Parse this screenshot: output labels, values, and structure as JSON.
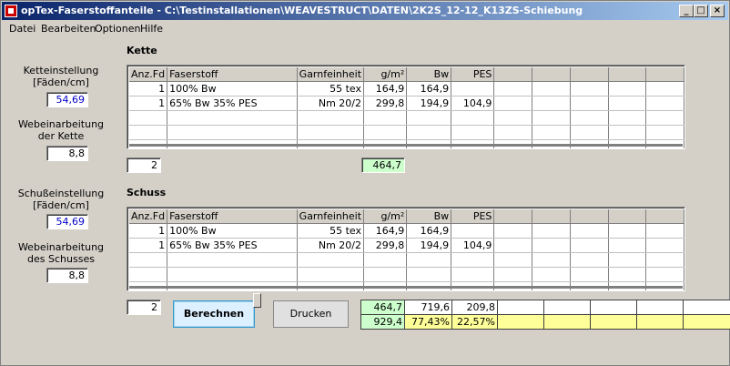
{
  "window": {
    "title": "opTex-Faserstoffanteile - C:\\Testinstallationen\\WEAVESTRUCT\\DATEN\\2K2S_12-12_K13ZS-Schiebung"
  },
  "menu": [
    "Datei",
    "Bearbeiten",
    "Optionen",
    "Hilfe"
  ],
  "kette": {
    "title": "Kette",
    "einstellung_label": "Ketteinstellung\n[Fäden/cm]",
    "einstellung_value": "54,69",
    "webe_label": "Webeinarbeitung\nder Kette",
    "webe_value": "8,8",
    "count": "2",
    "sum_gm2": "464,7",
    "columns": [
      "Anz.Fd",
      "Faserstoff",
      "Garnfeinheit",
      "g/m²",
      "Bw",
      "PES",
      "",
      "",
      "",
      "",
      ""
    ],
    "rows": [
      [
        "1",
        "100% Bw",
        "55 tex",
        "164,9",
        "164,9",
        ""
      ],
      [
        "1",
        "65% Bw  35% PES",
        "Nm 20/2",
        "299,8",
        "194,9",
        "104,9"
      ]
    ]
  },
  "schuss": {
    "title": "Schuss",
    "einstellung_label": "Schußeinstellung\n[Fäden/cm]",
    "einstellung_value": "54,69",
    "webe_label": "Webeinarbeitung\ndes Schusses",
    "webe_value": "8,8",
    "count": "2",
    "columns": [
      "Anz.Fd",
      "Faserstoff",
      "Garnfeinheit",
      "g/m²",
      "Bw",
      "PES",
      "",
      "",
      "",
      "",
      ""
    ],
    "rows": [
      [
        "1",
        "100% Bw",
        "55 tex",
        "164,9",
        "164,9",
        ""
      ],
      [
        "1",
        "65% Bw  35% PES",
        "Nm 20/2",
        "299,8",
        "194,9",
        "104,9"
      ]
    ]
  },
  "summary": {
    "row1": [
      "464,7",
      "719,6",
      "209,8",
      "",
      "",
      "",
      "",
      ""
    ],
    "row2": [
      "929,4",
      "77,43%",
      "22,57%",
      "",
      "",
      "",
      "",
      ""
    ]
  },
  "buttons": {
    "calculate": "Berechnen",
    "print": "Drucken"
  },
  "titlebar_buttons": {
    "minimize": "_",
    "maximize": "□",
    "close": "×"
  }
}
